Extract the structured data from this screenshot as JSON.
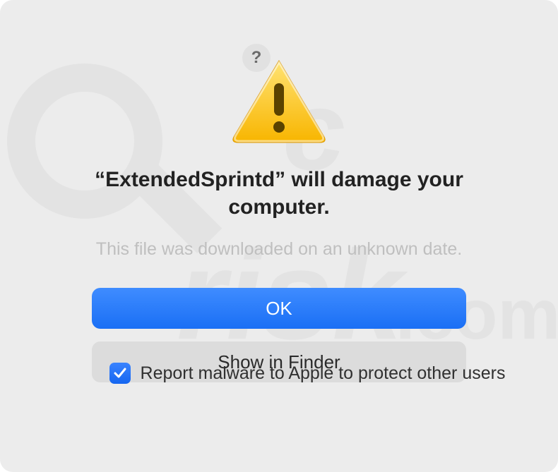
{
  "dialog": {
    "help_tooltip": "?",
    "title": "“ExtendedSprintd” will damage your computer.",
    "subtitle": "This file was downloaded on an unknown date.",
    "buttons": {
      "ok": "OK",
      "show_in_finder": "Show in Finder"
    },
    "checkbox": {
      "checked": true,
      "label": "Report malware to Apple to protect other users"
    }
  },
  "icons": {
    "warning": "warning-triangle",
    "help": "question-mark",
    "checkmark": "checkmark"
  },
  "colors": {
    "primary_button": "#2b7af7",
    "secondary_button": "#dcdcdc",
    "dialog_bg": "#ececec",
    "text_muted": "#bfbfbf"
  }
}
